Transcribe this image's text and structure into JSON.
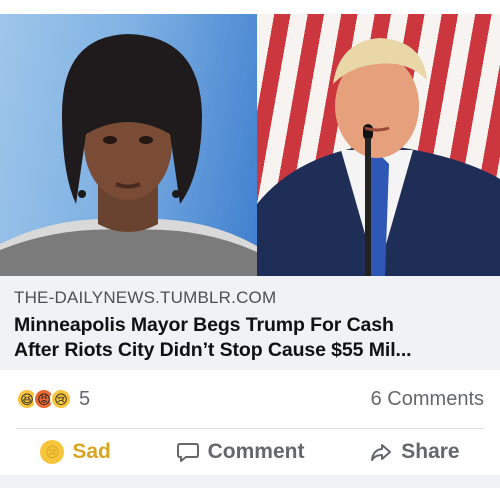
{
  "link_preview": {
    "domain": "THE-DAILYNEWS.TUMBLR.COM",
    "headline_line1": "Minneapolis Mayor Begs Trump For Cash",
    "headline_line2": "After Riots City Didn’t Stop Cause $55 Mil..."
  },
  "stats": {
    "reaction_icons": [
      "haha-emoji-icon",
      "angry-emoji-icon",
      "sad-emoji-icon"
    ],
    "reaction_count": "5",
    "comments": "6 Comments"
  },
  "actions": {
    "sad_label": "Sad",
    "comment_label": "Comment",
    "share_label": "Share"
  },
  "colors": {
    "link_background": "#f0f2f5",
    "muted_text": "#65676b",
    "sad_active": "#d9a520"
  }
}
